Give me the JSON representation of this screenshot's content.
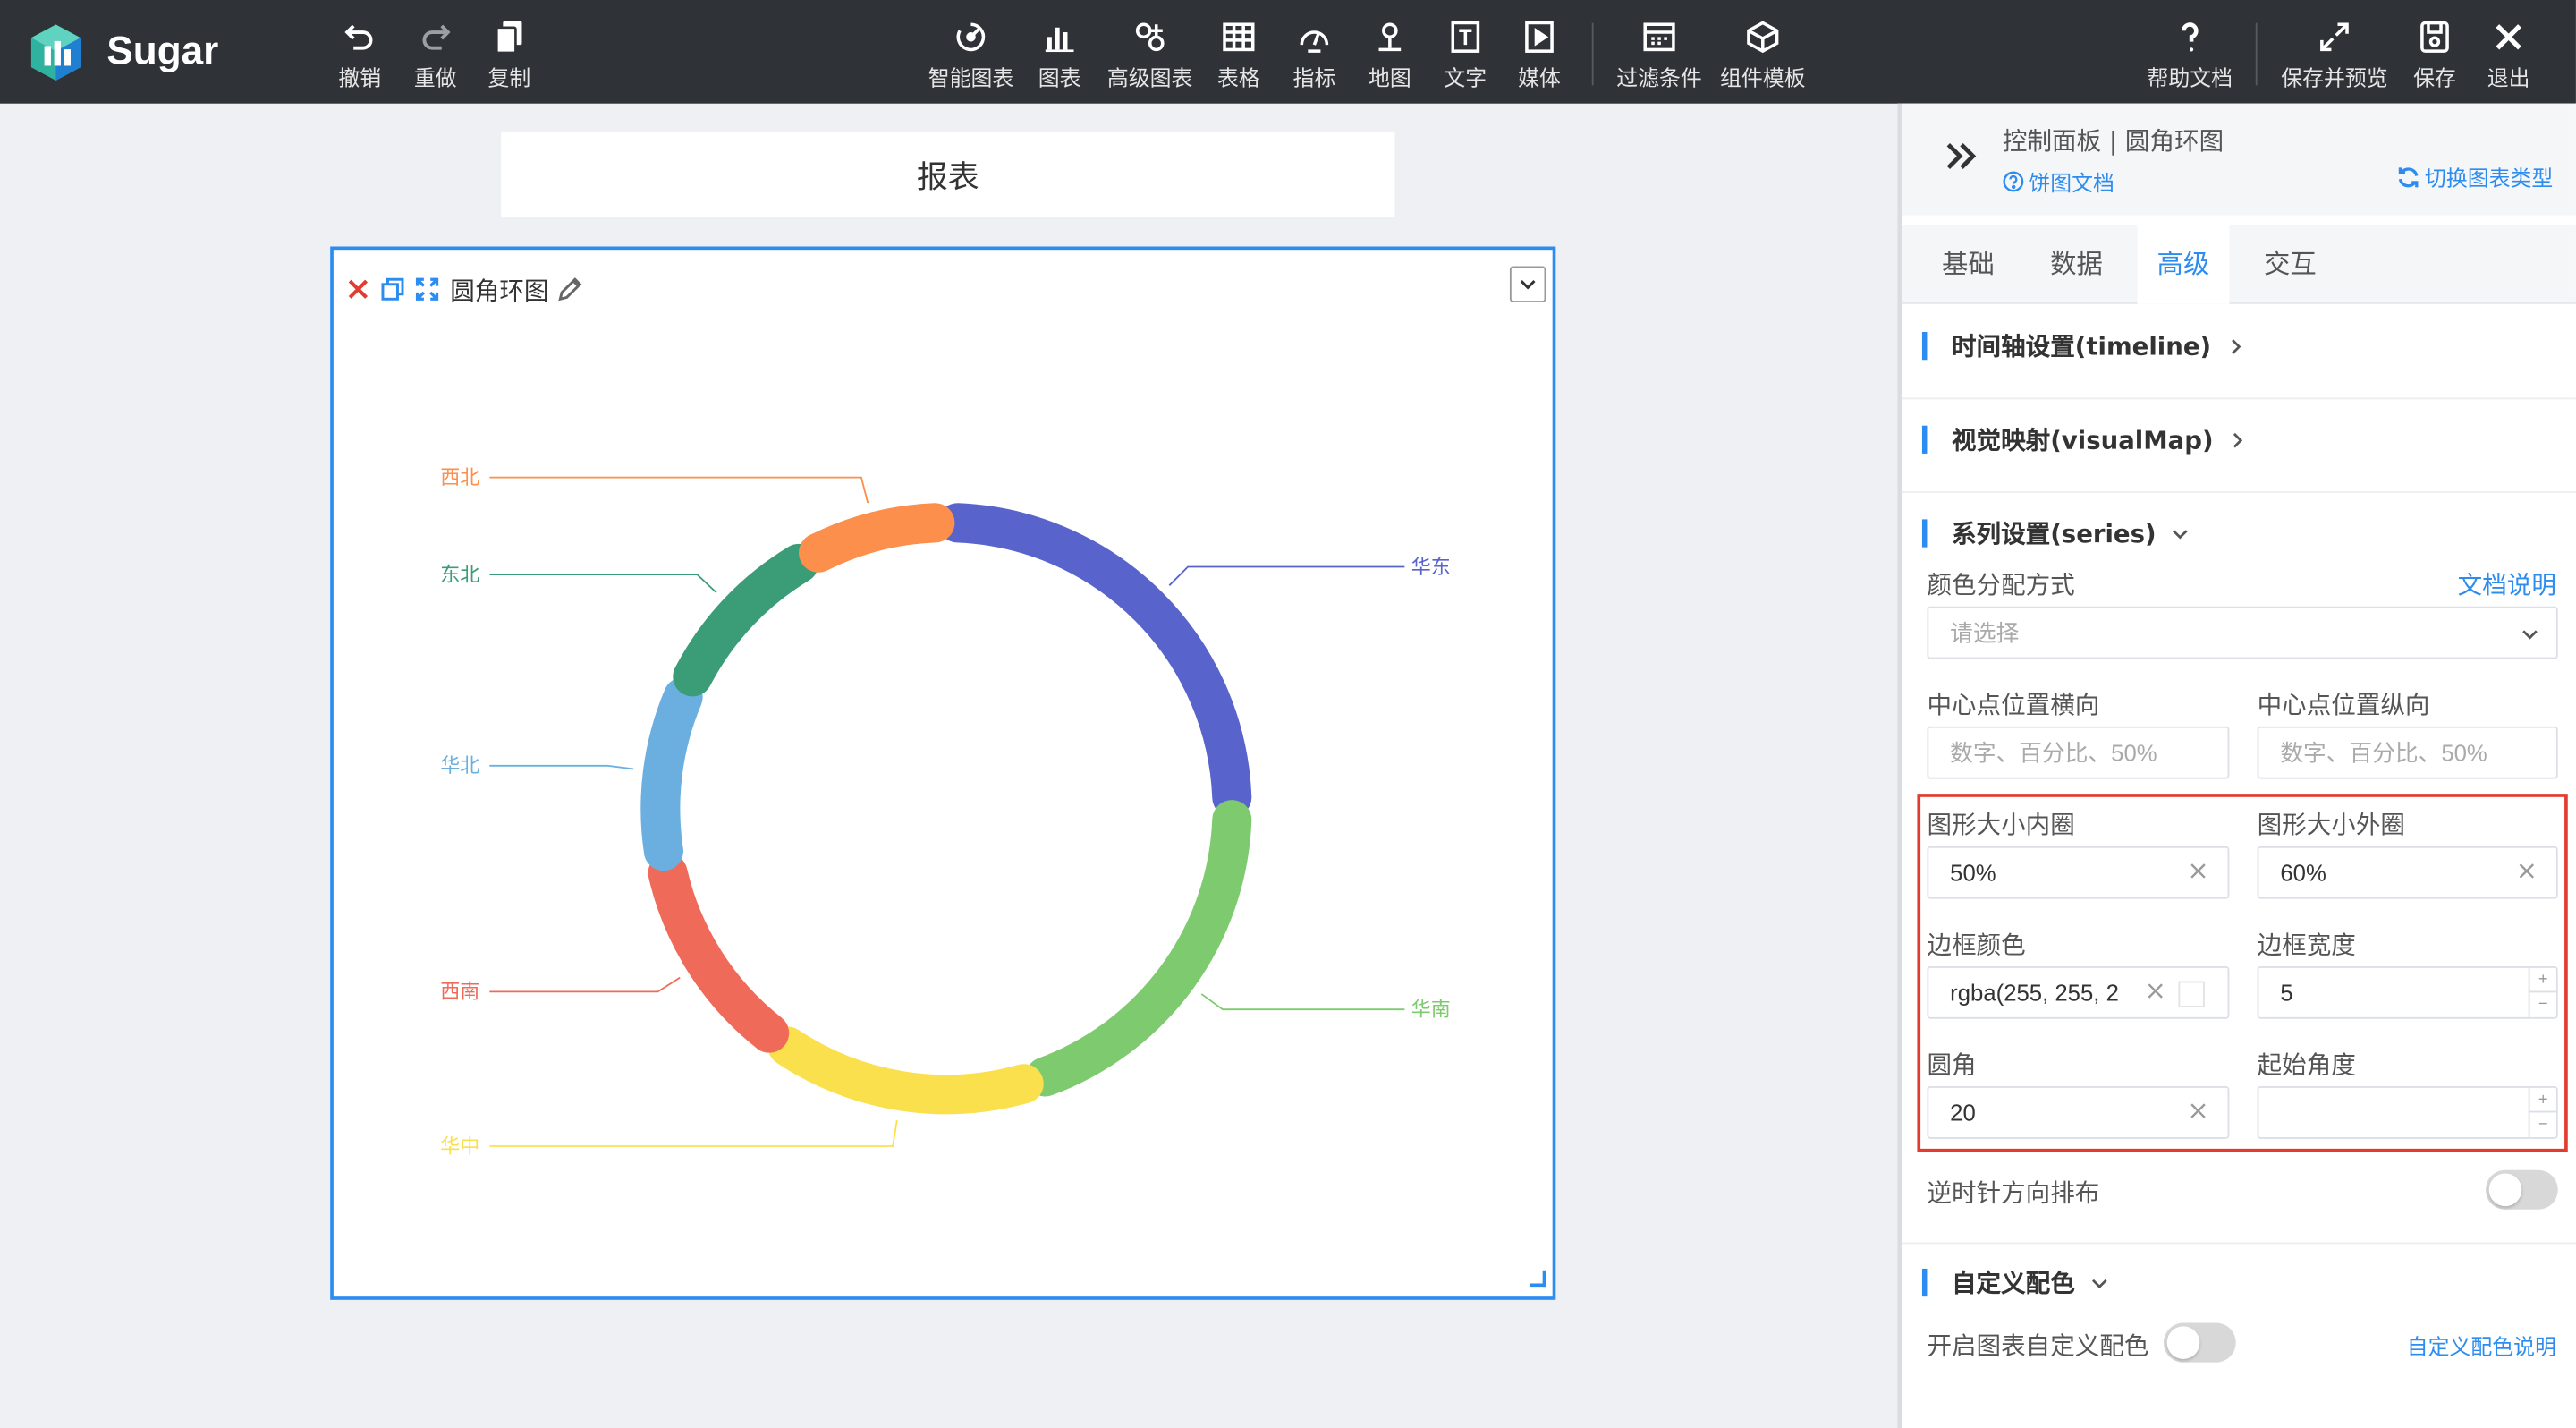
{
  "app": {
    "name": "Sugar"
  },
  "toolbar": {
    "left": [
      {
        "id": "undo",
        "label": "撤销",
        "icon": "undo-icon"
      },
      {
        "id": "redo",
        "label": "重做",
        "icon": "redo-icon"
      },
      {
        "id": "copy",
        "label": "复制",
        "icon": "copy-icon"
      }
    ],
    "center": [
      {
        "id": "smart-chart",
        "label": "智能图表",
        "icon": "smart-chart-icon"
      },
      {
        "id": "chart",
        "label": "图表",
        "icon": "bar-chart-icon"
      },
      {
        "id": "advanced-chart",
        "label": "高级图表",
        "icon": "advanced-chart-icon"
      },
      {
        "id": "table",
        "label": "表格",
        "icon": "table-icon"
      },
      {
        "id": "metric",
        "label": "指标",
        "icon": "gauge-icon"
      },
      {
        "id": "map",
        "label": "地图",
        "icon": "map-pin-icon"
      },
      {
        "id": "text",
        "label": "文字",
        "icon": "text-icon"
      },
      {
        "id": "media",
        "label": "媒体",
        "icon": "media-icon"
      },
      {
        "id": "filter",
        "label": "过滤条件",
        "icon": "filter-icon"
      },
      {
        "id": "component-template",
        "label": "组件模板",
        "icon": "cube-icon"
      }
    ],
    "right": [
      {
        "id": "help",
        "label": "帮助文档",
        "icon": "help-icon"
      },
      {
        "id": "save-preview",
        "label": "保存并预览",
        "icon": "expand-icon"
      },
      {
        "id": "save",
        "label": "保存",
        "icon": "save-icon"
      },
      {
        "id": "exit",
        "label": "退出",
        "icon": "close-icon"
      }
    ]
  },
  "report": {
    "title": "报表"
  },
  "chart_widget": {
    "title": "圆角环图"
  },
  "chart_data": {
    "type": "pie",
    "series": [
      {
        "name": "华东",
        "value": 25,
        "color": "#5864cc"
      },
      {
        "name": "华南",
        "value": 20,
        "color": "#7ecb6f"
      },
      {
        "name": "华中",
        "value": 15,
        "color": "#fbe04e"
      },
      {
        "name": "西南",
        "value": 12,
        "color": "#f06a5a"
      },
      {
        "name": "华北",
        "value": 10,
        "color": "#6aafe0"
      },
      {
        "name": "东北",
        "value": 10,
        "color": "#3a9d77"
      },
      {
        "name": "西北",
        "value": 8,
        "color": "#fb8f4b"
      }
    ],
    "inner_radius": "50%",
    "outer_radius": "60%",
    "border_radius": 20,
    "border_width": 5,
    "start_angle_deg": 90,
    "legend": "none"
  },
  "panel": {
    "breadcrumb": "控制面板 | 圆角环图",
    "doc_link": "饼图文档",
    "switch_link": "切换图表类型",
    "tabs": [
      "基础",
      "数据",
      "高级",
      "交互"
    ],
    "active_tab": "高级",
    "sections": {
      "timeline": "时间轴设置(timeline)",
      "visualmap": "视觉映射(visualMap)",
      "series": "系列设置(series)",
      "custom_color": "自定义配色"
    },
    "color_mode": {
      "label": "颜色分配方式",
      "doc": "文档说明",
      "placeholder": "请选择"
    },
    "center_x": {
      "label": "中心点位置横向",
      "placeholder": "数字、百分比、50%"
    },
    "center_y": {
      "label": "中心点位置纵向",
      "placeholder": "数字、百分比、50%"
    },
    "inner_radius": {
      "label": "图形大小内圈",
      "value": "50%"
    },
    "outer_radius": {
      "label": "图形大小外圈",
      "value": "60%"
    },
    "border_color": {
      "label": "边框颜色",
      "value": "rgba(255, 255, 2"
    },
    "border_width": {
      "label": "边框宽度",
      "value": "5"
    },
    "corner_radius": {
      "label": "圆角",
      "value": "20"
    },
    "start_angle": {
      "label": "起始角度",
      "value": ""
    },
    "counterclockwise": {
      "label": "逆时针方向排布",
      "on": false
    },
    "custom_color": {
      "label": "开启图表自定义配色",
      "doc": "自定义配色说明",
      "on": false
    }
  }
}
